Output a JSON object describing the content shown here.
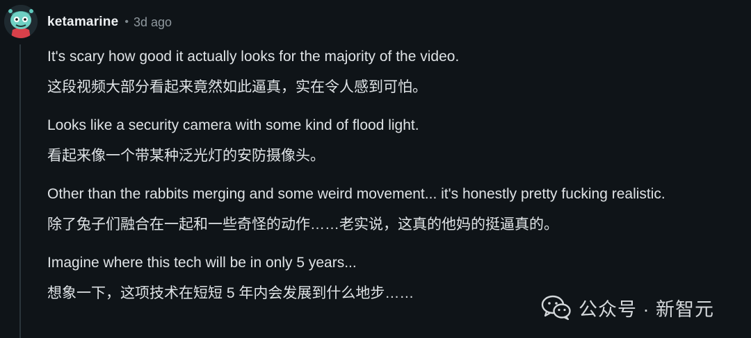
{
  "comment": {
    "username": "ketamarine",
    "separator": "•",
    "timestamp": "3d ago",
    "paragraphs": [
      {
        "english": "It's scary how good it actually looks for the majority of the video.",
        "chinese": "这段视频大部分看起来竟然如此逼真，实在令人感到可怕。"
      },
      {
        "english": "Looks like a security camera with some kind of flood light.",
        "chinese": "看起来像一个带某种泛光灯的安防摄像头。"
      },
      {
        "english": "Other than the rabbits merging and some weird movement... it's honestly pretty fucking realistic.",
        "chinese": "除了兔子们融合在一起和一些奇怪的动作……老实说，这真的他妈的挺逼真的。"
      },
      {
        "english": "Imagine where this tech will be in only 5 years...",
        "chinese": "想象一下，这项技术在短短 5 年内会发展到什么地步……"
      }
    ]
  },
  "watermark": {
    "text": "公众号 · 新智元",
    "icon": "wechat-icon"
  },
  "colors": {
    "background": "#0f1418",
    "avatar_accent": "#5fc9bd",
    "text": "#dfe3e6"
  }
}
